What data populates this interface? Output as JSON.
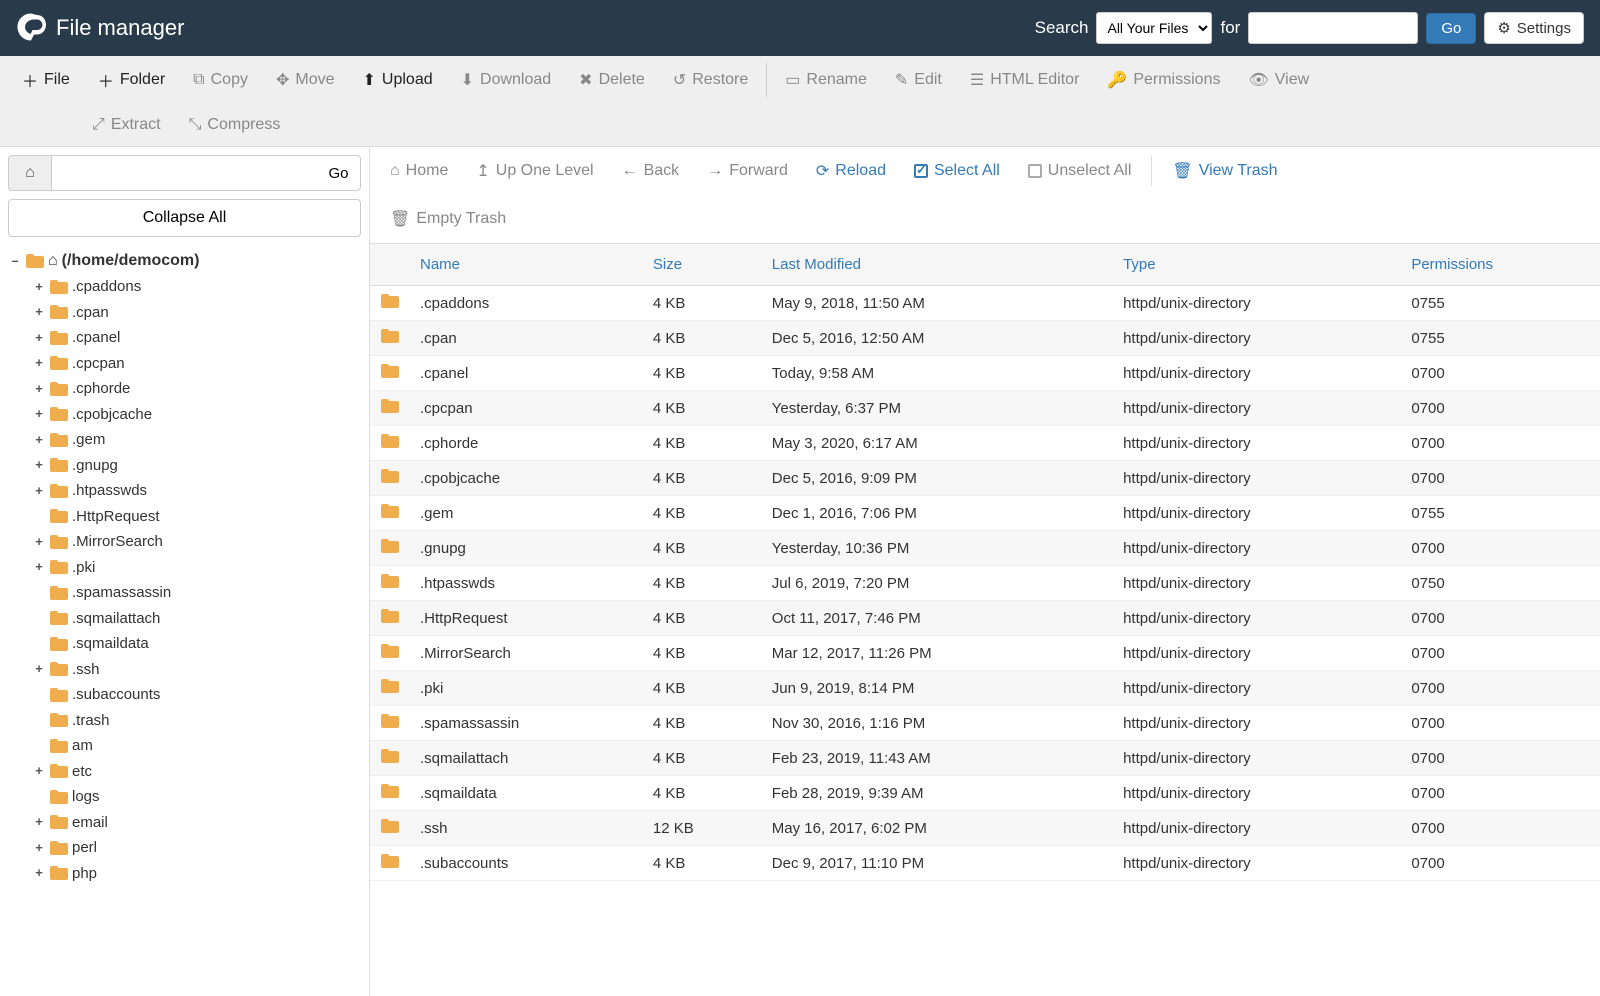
{
  "header": {
    "app_title": "File manager",
    "search_label": "Search",
    "for_label": "for",
    "search_scope": "All Your Files",
    "search_value": "",
    "go_label": "Go",
    "settings_label": "Settings"
  },
  "toolbar": {
    "file": "File",
    "folder": "Folder",
    "copy": "Copy",
    "move": "Move",
    "upload": "Upload",
    "download": "Download",
    "delete": "Delete",
    "restore": "Restore",
    "rename": "Rename",
    "edit": "Edit",
    "html_editor": "HTML Editor",
    "permissions": "Permissions",
    "view": "View",
    "extract": "Extract",
    "compress": "Compress"
  },
  "left": {
    "path_value": "",
    "go_label": "Go",
    "collapse_label": "Collapse All",
    "root_label": "(/home/democom)",
    "tree": [
      {
        "label": ".cpaddons",
        "expandable": true
      },
      {
        "label": ".cpan",
        "expandable": true
      },
      {
        "label": ".cpanel",
        "expandable": true
      },
      {
        "label": ".cpcpan",
        "expandable": true
      },
      {
        "label": ".cphorde",
        "expandable": true
      },
      {
        "label": ".cpobjcache",
        "expandable": true
      },
      {
        "label": ".gem",
        "expandable": true
      },
      {
        "label": ".gnupg",
        "expandable": true
      },
      {
        "label": ".htpasswds",
        "expandable": true
      },
      {
        "label": ".HttpRequest",
        "expandable": false
      },
      {
        "label": ".MirrorSearch",
        "expandable": true
      },
      {
        "label": ".pki",
        "expandable": true
      },
      {
        "label": ".spamassassin",
        "expandable": false
      },
      {
        "label": ".sqmailattach",
        "expandable": false
      },
      {
        "label": ".sqmaildata",
        "expandable": false
      },
      {
        "label": ".ssh",
        "expandable": true
      },
      {
        "label": ".subaccounts",
        "expandable": false
      },
      {
        "label": ".trash",
        "expandable": false
      },
      {
        "label": "am",
        "expandable": false
      },
      {
        "label": "etc",
        "expandable": true
      },
      {
        "label": "logs",
        "expandable": false
      },
      {
        "label": "email",
        "expandable": true
      },
      {
        "label": "perl",
        "expandable": true
      },
      {
        "label": "php",
        "expandable": true
      }
    ]
  },
  "actionbar": {
    "home": "Home",
    "up": "Up One Level",
    "back": "Back",
    "forward": "Forward",
    "reload": "Reload",
    "select_all": "Select All",
    "unselect_all": "Unselect All",
    "view_trash": "View Trash",
    "empty_trash": "Empty Trash"
  },
  "columns": {
    "name": "Name",
    "size": "Size",
    "last_modified": "Last Modified",
    "type": "Type",
    "permissions": "Permissions"
  },
  "rows": [
    {
      "name": ".cpaddons",
      "size": "4 KB",
      "modified": "May 9, 2018, 11:50 AM",
      "type": "httpd/unix-directory",
      "perm": "0755"
    },
    {
      "name": ".cpan",
      "size": "4 KB",
      "modified": "Dec 5, 2016, 12:50 AM",
      "type": "httpd/unix-directory",
      "perm": "0755"
    },
    {
      "name": ".cpanel",
      "size": "4 KB",
      "modified": "Today, 9:58 AM",
      "type": "httpd/unix-directory",
      "perm": "0700"
    },
    {
      "name": ".cpcpan",
      "size": "4 KB",
      "modified": "Yesterday, 6:37 PM",
      "type": "httpd/unix-directory",
      "perm": "0700"
    },
    {
      "name": ".cphorde",
      "size": "4 KB",
      "modified": "May 3, 2020, 6:17 AM",
      "type": "httpd/unix-directory",
      "perm": "0700"
    },
    {
      "name": ".cpobjcache",
      "size": "4 KB",
      "modified": "Dec 5, 2016, 9:09 PM",
      "type": "httpd/unix-directory",
      "perm": "0700"
    },
    {
      "name": ".gem",
      "size": "4 KB",
      "modified": "Dec 1, 2016, 7:06 PM",
      "type": "httpd/unix-directory",
      "perm": "0755"
    },
    {
      "name": ".gnupg",
      "size": "4 KB",
      "modified": "Yesterday, 10:36 PM",
      "type": "httpd/unix-directory",
      "perm": "0700"
    },
    {
      "name": ".htpasswds",
      "size": "4 KB",
      "modified": "Jul 6, 2019, 7:20 PM",
      "type": "httpd/unix-directory",
      "perm": "0750"
    },
    {
      "name": ".HttpRequest",
      "size": "4 KB",
      "modified": "Oct 11, 2017, 7:46 PM",
      "type": "httpd/unix-directory",
      "perm": "0700"
    },
    {
      "name": ".MirrorSearch",
      "size": "4 KB",
      "modified": "Mar 12, 2017, 11:26 PM",
      "type": "httpd/unix-directory",
      "perm": "0700"
    },
    {
      "name": ".pki",
      "size": "4 KB",
      "modified": "Jun 9, 2019, 8:14 PM",
      "type": "httpd/unix-directory",
      "perm": "0700"
    },
    {
      "name": ".spamassassin",
      "size": "4 KB",
      "modified": "Nov 30, 2016, 1:16 PM",
      "type": "httpd/unix-directory",
      "perm": "0700"
    },
    {
      "name": ".sqmailattach",
      "size": "4 KB",
      "modified": "Feb 23, 2019, 11:43 AM",
      "type": "httpd/unix-directory",
      "perm": "0700"
    },
    {
      "name": ".sqmaildata",
      "size": "4 KB",
      "modified": "Feb 28, 2019, 9:39 AM",
      "type": "httpd/unix-directory",
      "perm": "0700"
    },
    {
      "name": ".ssh",
      "size": "12 KB",
      "modified": "May 16, 2017, 6:02 PM",
      "type": "httpd/unix-directory",
      "perm": "0700"
    },
    {
      "name": ".subaccounts",
      "size": "4 KB",
      "modified": "Dec 9, 2017, 11:10 PM",
      "type": "httpd/unix-directory",
      "perm": "0700"
    }
  ]
}
